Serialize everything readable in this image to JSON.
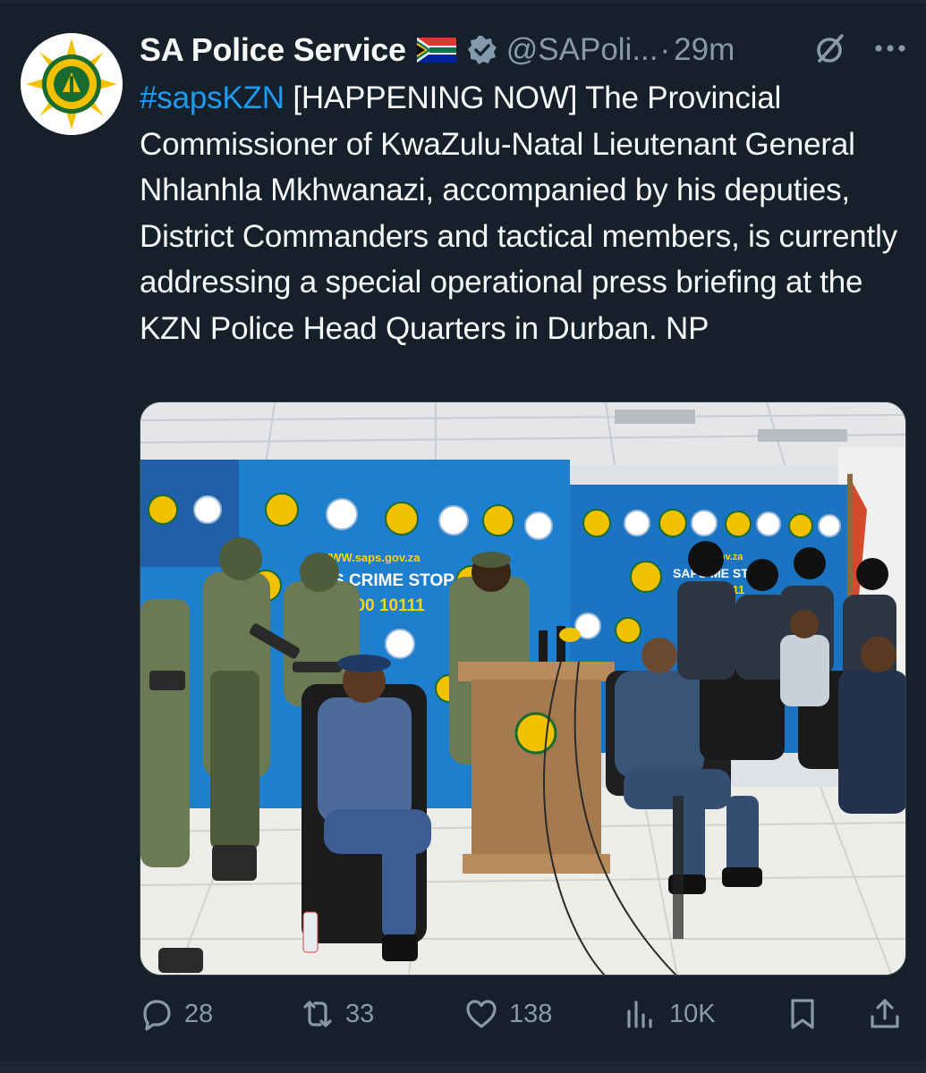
{
  "tweet": {
    "display_name": "SA Police Service",
    "handle": "@SAPoli...",
    "separator": "·",
    "time": "29m",
    "hashtag": "#sapsKZN",
    "text": " [HAPPENING NOW] The Provincial Commissioner of KwaZulu-Natal Lieutenant General Nhlanhla Mkhwanazi, accompanied by his deputies, District Commanders and tactical members, is currently addressing a special operational press briefing at the KZN Police Head Quarters in Durban. NP"
  },
  "media": {
    "banner_url_left": "WWW.saps.gov.za",
    "banner_slogan_left": "S CRIME STOP",
    "banner_number_left": "600 10111",
    "banner_url_right": "gov.za",
    "banner_slogan_right": "SAPS ME STO",
    "banner_number_right": "111"
  },
  "actions": {
    "replies": "28",
    "reposts": "33",
    "likes": "138",
    "views": "10K"
  },
  "icons": {
    "flag": "south-africa-flag-icon",
    "verified": "verified-badge-icon",
    "grok": "grok-icon",
    "more": "more-icon",
    "reply": "reply-icon",
    "repost": "repost-icon",
    "like": "heart-icon",
    "views": "views-icon",
    "bookmark": "bookmark-icon",
    "share": "share-icon"
  },
  "colors": {
    "background": "#15202b",
    "text": "#f7f9f9",
    "secondary": "#8b98a5",
    "accent": "#1d9bf0"
  }
}
